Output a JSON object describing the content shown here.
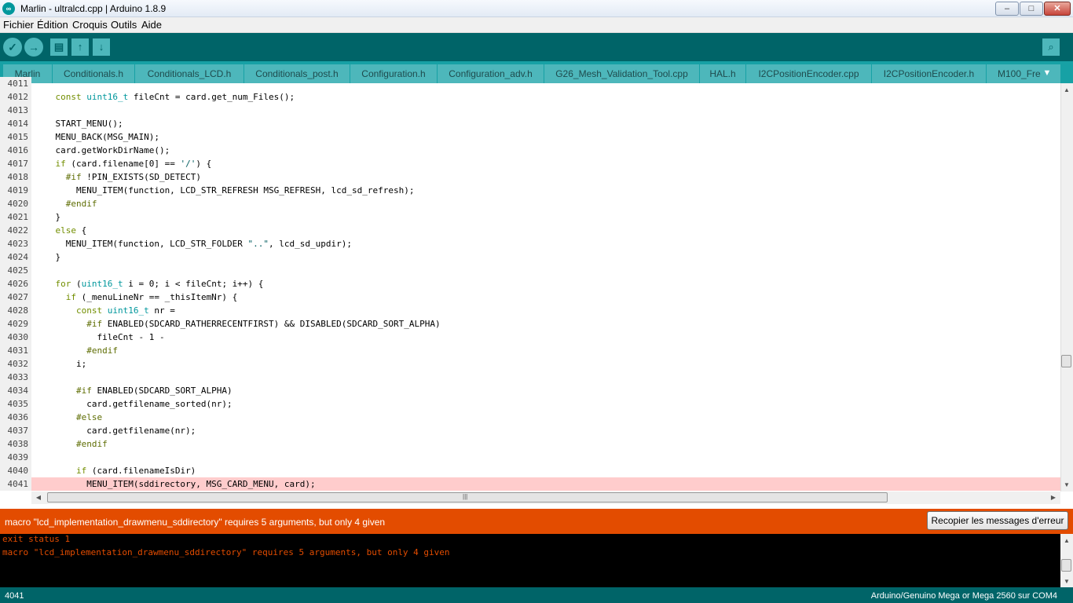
{
  "window": {
    "title": "Marlin - ultralcd.cpp | Arduino 1.8.9",
    "controls": {
      "minimize": "–",
      "maximize": "□",
      "close": "✕"
    }
  },
  "menu": [
    "Fichier",
    "Édition",
    "Croquis",
    "Outils",
    "Aide"
  ],
  "toolbar": {
    "verify_icon": "✓",
    "upload_icon": "→",
    "new_icon": "▤",
    "open_icon": "↑",
    "save_icon": "↓",
    "serial_icon": "⌕"
  },
  "tabs": [
    {
      "label": "Marlin",
      "active": false
    },
    {
      "label": "Conditionals.h",
      "active": false
    },
    {
      "label": "Conditionals_LCD.h",
      "active": false
    },
    {
      "label": "Conditionals_post.h",
      "active": false
    },
    {
      "label": "Configuration.h",
      "active": false
    },
    {
      "label": "Configuration_adv.h",
      "active": false
    },
    {
      "label": "G26_Mesh_Validation_Tool.cpp",
      "active": false
    },
    {
      "label": "HAL.h",
      "active": false
    },
    {
      "label": "I2CPositionEncoder.cpp",
      "active": false
    },
    {
      "label": "I2CPositionEncoder.h",
      "active": false
    },
    {
      "label": "M100_Fre",
      "active": false
    }
  ],
  "tab_more_icon": "▼",
  "editor": {
    "highlighted_line": "4041",
    "lines": [
      {
        "n": "4011",
        "html": ""
      },
      {
        "n": "4012",
        "html": "    <span class='kw'>const</span> <span class='ty'>uint16_t</span> fileCnt = card.get_num_Files();"
      },
      {
        "n": "4013",
        "html": ""
      },
      {
        "n": "4014",
        "html": "    START_MENU();"
      },
      {
        "n": "4015",
        "html": "    MENU_BACK(MSG_MAIN);"
      },
      {
        "n": "4016",
        "html": "    card.getWorkDirName();"
      },
      {
        "n": "4017",
        "html": "    <span class='kw'>if</span> (card.filename[0] == <span class='str'>'/'</span>) {"
      },
      {
        "n": "4018",
        "html": "      <span class='pp'>#if</span> !PIN_EXISTS(SD_DETECT)"
      },
      {
        "n": "4019",
        "html": "        MENU_ITEM(function, LCD_STR_REFRESH MSG_REFRESH, lcd_sd_refresh);"
      },
      {
        "n": "4020",
        "html": "      <span class='pp'>#endif</span>"
      },
      {
        "n": "4021",
        "html": "    }"
      },
      {
        "n": "4022",
        "html": "    <span class='kw'>else</span> {"
      },
      {
        "n": "4023",
        "html": "      MENU_ITEM(function, LCD_STR_FOLDER <span class='str'>\"..\"</span>, lcd_sd_updir);"
      },
      {
        "n": "4024",
        "html": "    }"
      },
      {
        "n": "4025",
        "html": ""
      },
      {
        "n": "4026",
        "html": "    <span class='kw'>for</span> (<span class='ty'>uint16_t</span> i = 0; i &lt; fileCnt; i++) {"
      },
      {
        "n": "4027",
        "html": "      <span class='kw'>if</span> (_menuLineNr == _thisItemNr) {"
      },
      {
        "n": "4028",
        "html": "        <span class='kw'>const</span> <span class='ty'>uint16_t</span> nr ="
      },
      {
        "n": "4029",
        "html": "          <span class='pp'>#if</span> ENABLED(SDCARD_RATHERRECENTFIRST) &amp;&amp; DISABLED(SDCARD_SORT_ALPHA)"
      },
      {
        "n": "4030",
        "html": "            fileCnt - 1 -"
      },
      {
        "n": "4031",
        "html": "          <span class='pp'>#endif</span>"
      },
      {
        "n": "4032",
        "html": "        i;"
      },
      {
        "n": "4033",
        "html": ""
      },
      {
        "n": "4034",
        "html": "        <span class='pp'>#if</span> ENABLED(SDCARD_SORT_ALPHA)"
      },
      {
        "n": "4035",
        "html": "          card.getfilename_sorted(nr);"
      },
      {
        "n": "4036",
        "html": "        <span class='pp'>#else</span>"
      },
      {
        "n": "4037",
        "html": "          card.getfilename(nr);"
      },
      {
        "n": "4038",
        "html": "        <span class='pp'>#endif</span>"
      },
      {
        "n": "4039",
        "html": ""
      },
      {
        "n": "4040",
        "html": "        <span class='kw'>if</span> (card.filenameIsDir)"
      },
      {
        "n": "4041",
        "html": "          MENU_ITEM(sddirectory, MSG_CARD_MENU, card);"
      }
    ]
  },
  "scroll_icons": {
    "up": "▲",
    "down": "▼",
    "left": "◀",
    "right": "▶",
    "grip": "|||"
  },
  "error": {
    "message": "macro \"lcd_implementation_drawmenu_sddirectory\" requires 5 arguments, but only 4 given",
    "copy_button": "Recopier les messages d'erreur"
  },
  "console": [
    "exit status 1",
    "macro \"lcd_implementation_drawmenu_sddirectory\" requires 5 arguments, but only 4 given"
  ],
  "status": {
    "line": "4041",
    "board": "Arduino/Genuino Mega or Mega 2560 sur COM4"
  },
  "colors": {
    "toolbar": "#006468",
    "tabbar": "#17a1a5",
    "tab": "#4db7bb",
    "error_bar": "#e34c00",
    "highlight_line": "#ffcccc"
  }
}
